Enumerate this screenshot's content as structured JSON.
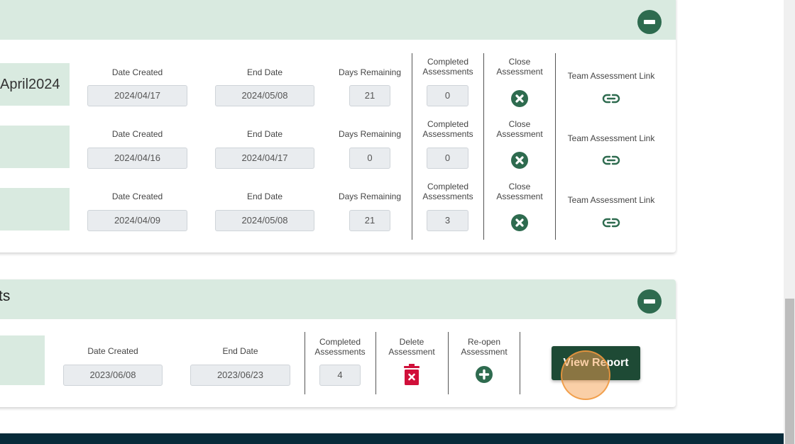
{
  "active_section": {
    "collapse_icon": "minus-circle-icon",
    "rows": [
      {
        "name": "April2024",
        "date_created_label": "Date Created",
        "date_created": "2024/04/17",
        "end_date_label": "End Date",
        "end_date": "2024/05/08",
        "days_remaining_label": "Days Remaining",
        "days_remaining": "21",
        "completed_label": "Completed Assessments",
        "completed": "0",
        "close_label": "Close Assessment",
        "close_icon": "x-circle-icon",
        "link_label": "Team Assessment Link",
        "link_icon": "link-icon"
      },
      {
        "name": "",
        "date_created_label": "Date Created",
        "date_created": "2024/04/16",
        "end_date_label": "End Date",
        "end_date": "2024/04/17",
        "days_remaining_label": "Days Remaining",
        "days_remaining": "0",
        "completed_label": "Completed Assessments",
        "completed": "0",
        "close_label": "Close Assessment",
        "close_icon": "x-circle-icon",
        "link_label": "Team Assessment Link",
        "link_icon": "link-icon"
      },
      {
        "name": "",
        "date_created_label": "Date Created",
        "date_created": "2024/04/09",
        "end_date_label": "End Date",
        "end_date": "2024/05/08",
        "days_remaining_label": "Days Remaining",
        "days_remaining": "21",
        "completed_label": "Completed Assessments",
        "completed": "3",
        "close_label": "Close Assessment",
        "close_icon": "x-circle-icon",
        "link_label": "Team Assessment Link",
        "link_icon": "link-icon"
      }
    ]
  },
  "past_section": {
    "title_fragment": "ts",
    "collapse_icon": "minus-circle-icon",
    "rows": [
      {
        "name": "",
        "date_created_label": "Date Created",
        "date_created": "2023/06/08",
        "end_date_label": "End Date",
        "end_date": "2023/06/23",
        "completed_label": "Completed Assessments",
        "completed": "4",
        "delete_label": "Delete Assessment",
        "delete_icon": "trash-icon",
        "reopen_label": "Re-open Assessment",
        "reopen_icon": "plus-circle-icon",
        "view_report_label": "View Report"
      }
    ]
  },
  "colors": {
    "header_bg": "#d9eae0",
    "accent_green": "#2e6b4f",
    "button_dark_green": "#1e4a35",
    "delete_red": "#d0103a",
    "footer_navy": "#072b3a"
  }
}
